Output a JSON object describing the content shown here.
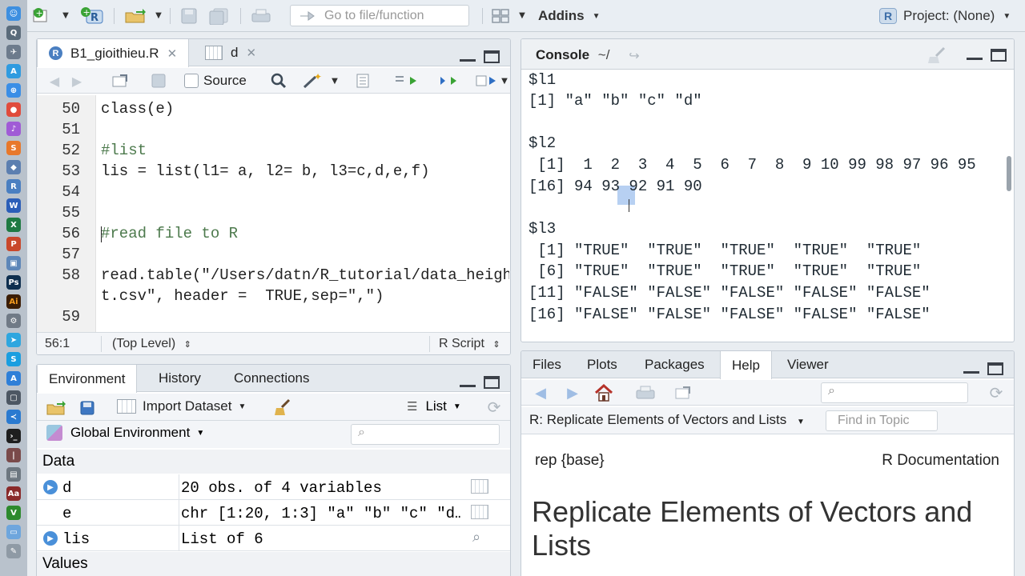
{
  "toolbar": {
    "goto_placeholder": "Go to file/function",
    "addins_label": "Addins",
    "project_label": "Project: (None)"
  },
  "editor": {
    "tabs": [
      {
        "label": "B1_gioithieu.R",
        "icon": "r-file-icon"
      },
      {
        "label": "d",
        "icon": "table-icon"
      }
    ],
    "source_label": "Source",
    "lines": [
      {
        "num": "50",
        "text": "class(e)"
      },
      {
        "num": "51",
        "text": ""
      },
      {
        "num": "52",
        "text": "#list"
      },
      {
        "num": "53",
        "text": "lis = list(l1= a, l2= b, l3=c,d,e,f)"
      },
      {
        "num": "54",
        "text": ""
      },
      {
        "num": "55",
        "text": ""
      },
      {
        "num": "56",
        "text": "#read file to R"
      },
      {
        "num": "57",
        "text": ""
      },
      {
        "num": "58",
        "text": "read.table(\"/Users/datn/R_tutorial/data_heigh"
      },
      {
        "num": "",
        "text": "t.csv\", header =  TRUE,sep=\",\")"
      },
      {
        "num": "59",
        "text": ""
      }
    ],
    "cursor_pos": "56:1",
    "scope": "(Top Level)",
    "file_type": "R Script"
  },
  "console": {
    "title": "Console",
    "path": "~/",
    "lines": [
      "$l1",
      "[1] \"a\" \"b\" \"c\" \"d\"",
      "",
      "$l2",
      " [1]  1  2  3  4  5  6  7  8  9 10 99 98 97 96 95",
      "[16] 94 93 92 91 90",
      "",
      "$l3",
      " [1] \"TRUE\"  \"TRUE\"  \"TRUE\"  \"TRUE\"  \"TRUE\"",
      " [6] \"TRUE\"  \"TRUE\"  \"TRUE\"  \"TRUE\"  \"TRUE\"",
      "[11] \"FALSE\" \"FALSE\" \"FALSE\" \"FALSE\" \"FALSE\"",
      "[16] \"FALSE\" \"FALSE\" \"FALSE\" \"FALSE\" \"FALSE\""
    ]
  },
  "environment": {
    "tabs": [
      "Environment",
      "History",
      "Connections"
    ],
    "import_label": "Import Dataset",
    "view_mode": "List",
    "scope_label": "Global Environment",
    "data_header": "Data",
    "values_header": "Values",
    "rows": [
      {
        "name": "d",
        "value": "20 obs. of 4 variables"
      },
      {
        "name": "e",
        "value": "chr [1:20, 1:3] \"a\" \"b\" \"c\" \"d…"
      },
      {
        "name": "lis",
        "value": "List of 6"
      }
    ]
  },
  "help": {
    "tabs": [
      "Files",
      "Plots",
      "Packages",
      "Help",
      "Viewer"
    ],
    "topic_label": "R: Replicate Elements of Vectors and Lists",
    "find_placeholder": "Find in Topic",
    "pkg_label": "rep {base}",
    "doc_label": "R Documentation",
    "title": "Replicate Elements of Vectors and Lists"
  },
  "colors": {
    "accent_blue": "#4a90d9",
    "green": "#3aa335",
    "string_green": "#2f6f2f",
    "keyword": "#b8860b"
  }
}
